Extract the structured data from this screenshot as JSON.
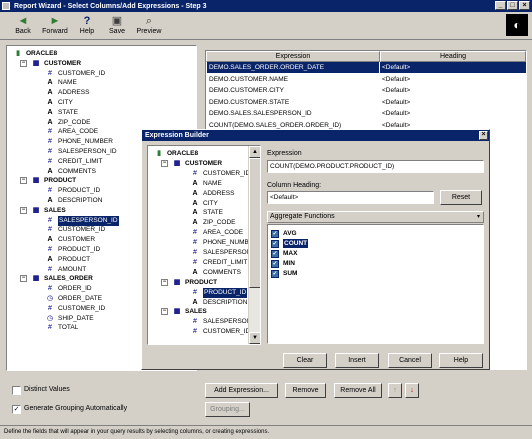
{
  "window": {
    "title": "Report Wizard - Select Columns/Add Expressions - Step 3",
    "controls": [
      "_",
      "□",
      "×"
    ]
  },
  "toolbar": {
    "back": "Back",
    "forward": "Forward",
    "help": "Help",
    "save": "Save",
    "preview": "Preview",
    "back_icon": "◄",
    "forward_icon": "►",
    "help_icon": "?",
    "save_icon": "▣",
    "preview_icon": "⌕"
  },
  "left_tree": {
    "root": "ORACLE8",
    "rows": [
      {
        "label": "CUSTOMER",
        "type": "table",
        "level": 1,
        "expander": "−"
      },
      {
        "label": "CUSTOMER_ID",
        "type": "num",
        "level": 2
      },
      {
        "label": "NAME",
        "type": "str",
        "level": 2
      },
      {
        "label": "ADDRESS",
        "type": "str",
        "level": 2
      },
      {
        "label": "CITY",
        "type": "str",
        "level": 2
      },
      {
        "label": "STATE",
        "type": "str",
        "level": 2
      },
      {
        "label": "ZIP_CODE",
        "type": "str",
        "level": 2
      },
      {
        "label": "AREA_CODE",
        "type": "num",
        "level": 2
      },
      {
        "label": "PHONE_NUMBER",
        "type": "num",
        "level": 2
      },
      {
        "label": "SALESPERSON_ID",
        "type": "num",
        "level": 2
      },
      {
        "label": "CREDIT_LIMIT",
        "type": "num",
        "level": 2
      },
      {
        "label": "COMMENTS",
        "type": "str",
        "level": 2
      },
      {
        "label": "PRODUCT",
        "type": "table",
        "level": 1,
        "expander": "−"
      },
      {
        "label": "PRODUCT_ID",
        "type": "num",
        "level": 2
      },
      {
        "label": "DESCRIPTION",
        "type": "str",
        "level": 2
      },
      {
        "label": "SALES",
        "type": "table",
        "level": 1,
        "expander": "−"
      },
      {
        "label": "SALESPERSON_ID",
        "type": "num",
        "level": 2,
        "selected": true
      },
      {
        "label": "CUSTOMER_ID",
        "type": "num",
        "level": 2
      },
      {
        "label": "CUSTOMER",
        "type": "str",
        "level": 2
      },
      {
        "label": "PRODUCT_ID",
        "type": "num",
        "level": 2
      },
      {
        "label": "PRODUCT",
        "type": "str",
        "level": 2
      },
      {
        "label": "AMOUNT",
        "type": "num",
        "level": 2
      },
      {
        "label": "SALES_ORDER",
        "type": "table",
        "level": 1,
        "expander": "−"
      },
      {
        "label": "ORDER_ID",
        "type": "num",
        "level": 2
      },
      {
        "label": "ORDER_DATE",
        "type": "date",
        "level": 2
      },
      {
        "label": "CUSTOMER_ID",
        "type": "num",
        "level": 2
      },
      {
        "label": "SHIP_DATE",
        "type": "date",
        "level": 2
      },
      {
        "label": "TOTAL",
        "type": "num",
        "level": 2
      }
    ]
  },
  "grid": {
    "headers": [
      "Expression",
      "Heading"
    ],
    "rows": [
      {
        "expression": "DEMO.SALES_ORDER.ORDER_DATE",
        "heading": "<Default>",
        "selected": true
      },
      {
        "expression": "DEMO.CUSTOMER.NAME",
        "heading": "<Default>"
      },
      {
        "expression": "DEMO.CUSTOMER.CITY",
        "heading": "<Default>"
      },
      {
        "expression": "DEMO.CUSTOMER.STATE",
        "heading": "<Default>"
      },
      {
        "expression": "DEMO.SALES.SALESPERSON_ID",
        "heading": "<Default>"
      },
      {
        "expression": "COUNT(DEMO.SALES_ORDER.ORDER_ID)",
        "heading": "<Default>"
      }
    ]
  },
  "bottom": {
    "distinct": "Distinct Values",
    "grouping_auto": "Generate Grouping Automatically",
    "grouping_checked": "✓",
    "add_expression": "Add Expression...",
    "remove": "Remove",
    "remove_all": "Remove All",
    "grouping_btn": "Grouping...",
    "up_arrow": "↑",
    "down_arrow": "↓"
  },
  "status_text": "Define the fields that will appear in your query results by selecting columns, or creating expressions.",
  "dialog": {
    "title": "Expression Builder",
    "close": "×",
    "expression_label": "Expression",
    "expression_value": "COUNT(DEMO.PRODUCT.PRODUCT_ID)",
    "heading_label": "Column Heading:",
    "heading_value": "<Default>",
    "reset": "Reset",
    "agg_label": "Aggregate Functions",
    "functions": [
      {
        "name": "AVG",
        "highlight": false
      },
      {
        "name": "COUNT",
        "highlight": true
      },
      {
        "name": "MAX",
        "highlight": false
      },
      {
        "name": "MIN",
        "highlight": false
      },
      {
        "name": "SUM",
        "highlight": false
      }
    ],
    "checkmark": "✓",
    "clear": "Clear",
    "insert": "Insert",
    "cancel": "Cancel",
    "help": "Help",
    "tree": {
      "root": "ORACLE8",
      "rows": [
        {
          "label": "CUSTOMER",
          "type": "table",
          "level": 1
        },
        {
          "label": "CUSTOMER_ID",
          "type": "num",
          "level": 2
        },
        {
          "label": "NAME",
          "type": "str",
          "level": 2
        },
        {
          "label": "ADDRESS",
          "type": "str",
          "level": 2
        },
        {
          "label": "CITY",
          "type": "str",
          "level": 2
        },
        {
          "label": "STATE",
          "type": "str",
          "level": 2
        },
        {
          "label": "ZIP_CODE",
          "type": "str",
          "level": 2
        },
        {
          "label": "AREA_CODE",
          "type": "num",
          "level": 2
        },
        {
          "label": "PHONE_NUMBER",
          "type": "num",
          "level": 2
        },
        {
          "label": "SALESPERSON_ID",
          "type": "num",
          "level": 2
        },
        {
          "label": "CREDIT_LIMIT",
          "type": "num",
          "level": 2
        },
        {
          "label": "COMMENTS",
          "type": "str",
          "level": 2
        },
        {
          "label": "PRODUCT",
          "type": "table",
          "level": 1
        },
        {
          "label": "PRODUCT_ID",
          "type": "num",
          "level": 2,
          "selected": true
        },
        {
          "label": "DESCRIPTION",
          "type": "str",
          "level": 2
        },
        {
          "label": "SALES",
          "type": "table",
          "level": 1
        },
        {
          "label": "SALESPERSON_ID",
          "type": "num",
          "level": 2
        },
        {
          "label": "CUSTOMER_ID",
          "type": "num",
          "level": 2
        }
      ]
    }
  },
  "glyphs": {
    "db": "▮",
    "table": "▦",
    "num": "#",
    "str": "A",
    "date": "◷",
    "expand": "−"
  }
}
